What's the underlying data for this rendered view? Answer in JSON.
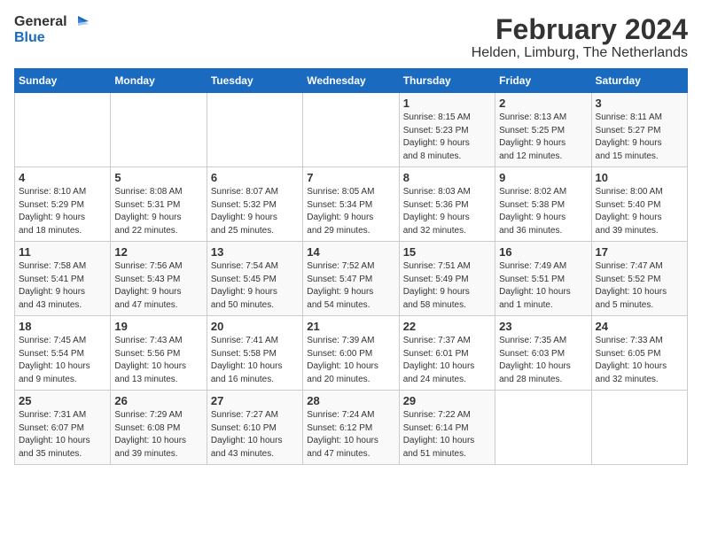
{
  "header": {
    "logo_general": "General",
    "logo_blue": "Blue",
    "month_year": "February 2024",
    "location": "Helden, Limburg, The Netherlands"
  },
  "weekdays": [
    "Sunday",
    "Monday",
    "Tuesday",
    "Wednesday",
    "Thursday",
    "Friday",
    "Saturday"
  ],
  "weeks": [
    [
      {
        "day": "",
        "info": ""
      },
      {
        "day": "",
        "info": ""
      },
      {
        "day": "",
        "info": ""
      },
      {
        "day": "",
        "info": ""
      },
      {
        "day": "1",
        "info": "Sunrise: 8:15 AM\nSunset: 5:23 PM\nDaylight: 9 hours\nand 8 minutes."
      },
      {
        "day": "2",
        "info": "Sunrise: 8:13 AM\nSunset: 5:25 PM\nDaylight: 9 hours\nand 12 minutes."
      },
      {
        "day": "3",
        "info": "Sunrise: 8:11 AM\nSunset: 5:27 PM\nDaylight: 9 hours\nand 15 minutes."
      }
    ],
    [
      {
        "day": "4",
        "info": "Sunrise: 8:10 AM\nSunset: 5:29 PM\nDaylight: 9 hours\nand 18 minutes."
      },
      {
        "day": "5",
        "info": "Sunrise: 8:08 AM\nSunset: 5:31 PM\nDaylight: 9 hours\nand 22 minutes."
      },
      {
        "day": "6",
        "info": "Sunrise: 8:07 AM\nSunset: 5:32 PM\nDaylight: 9 hours\nand 25 minutes."
      },
      {
        "day": "7",
        "info": "Sunrise: 8:05 AM\nSunset: 5:34 PM\nDaylight: 9 hours\nand 29 minutes."
      },
      {
        "day": "8",
        "info": "Sunrise: 8:03 AM\nSunset: 5:36 PM\nDaylight: 9 hours\nand 32 minutes."
      },
      {
        "day": "9",
        "info": "Sunrise: 8:02 AM\nSunset: 5:38 PM\nDaylight: 9 hours\nand 36 minutes."
      },
      {
        "day": "10",
        "info": "Sunrise: 8:00 AM\nSunset: 5:40 PM\nDaylight: 9 hours\nand 39 minutes."
      }
    ],
    [
      {
        "day": "11",
        "info": "Sunrise: 7:58 AM\nSunset: 5:41 PM\nDaylight: 9 hours\nand 43 minutes."
      },
      {
        "day": "12",
        "info": "Sunrise: 7:56 AM\nSunset: 5:43 PM\nDaylight: 9 hours\nand 47 minutes."
      },
      {
        "day": "13",
        "info": "Sunrise: 7:54 AM\nSunset: 5:45 PM\nDaylight: 9 hours\nand 50 minutes."
      },
      {
        "day": "14",
        "info": "Sunrise: 7:52 AM\nSunset: 5:47 PM\nDaylight: 9 hours\nand 54 minutes."
      },
      {
        "day": "15",
        "info": "Sunrise: 7:51 AM\nSunset: 5:49 PM\nDaylight: 9 hours\nand 58 minutes."
      },
      {
        "day": "16",
        "info": "Sunrise: 7:49 AM\nSunset: 5:51 PM\nDaylight: 10 hours\nand 1 minute."
      },
      {
        "day": "17",
        "info": "Sunrise: 7:47 AM\nSunset: 5:52 PM\nDaylight: 10 hours\nand 5 minutes."
      }
    ],
    [
      {
        "day": "18",
        "info": "Sunrise: 7:45 AM\nSunset: 5:54 PM\nDaylight: 10 hours\nand 9 minutes."
      },
      {
        "day": "19",
        "info": "Sunrise: 7:43 AM\nSunset: 5:56 PM\nDaylight: 10 hours\nand 13 minutes."
      },
      {
        "day": "20",
        "info": "Sunrise: 7:41 AM\nSunset: 5:58 PM\nDaylight: 10 hours\nand 16 minutes."
      },
      {
        "day": "21",
        "info": "Sunrise: 7:39 AM\nSunset: 6:00 PM\nDaylight: 10 hours\nand 20 minutes."
      },
      {
        "day": "22",
        "info": "Sunrise: 7:37 AM\nSunset: 6:01 PM\nDaylight: 10 hours\nand 24 minutes."
      },
      {
        "day": "23",
        "info": "Sunrise: 7:35 AM\nSunset: 6:03 PM\nDaylight: 10 hours\nand 28 minutes."
      },
      {
        "day": "24",
        "info": "Sunrise: 7:33 AM\nSunset: 6:05 PM\nDaylight: 10 hours\nand 32 minutes."
      }
    ],
    [
      {
        "day": "25",
        "info": "Sunrise: 7:31 AM\nSunset: 6:07 PM\nDaylight: 10 hours\nand 35 minutes."
      },
      {
        "day": "26",
        "info": "Sunrise: 7:29 AM\nSunset: 6:08 PM\nDaylight: 10 hours\nand 39 minutes."
      },
      {
        "day": "27",
        "info": "Sunrise: 7:27 AM\nSunset: 6:10 PM\nDaylight: 10 hours\nand 43 minutes."
      },
      {
        "day": "28",
        "info": "Sunrise: 7:24 AM\nSunset: 6:12 PM\nDaylight: 10 hours\nand 47 minutes."
      },
      {
        "day": "29",
        "info": "Sunrise: 7:22 AM\nSunset: 6:14 PM\nDaylight: 10 hours\nand 51 minutes."
      },
      {
        "day": "",
        "info": ""
      },
      {
        "day": "",
        "info": ""
      }
    ]
  ]
}
